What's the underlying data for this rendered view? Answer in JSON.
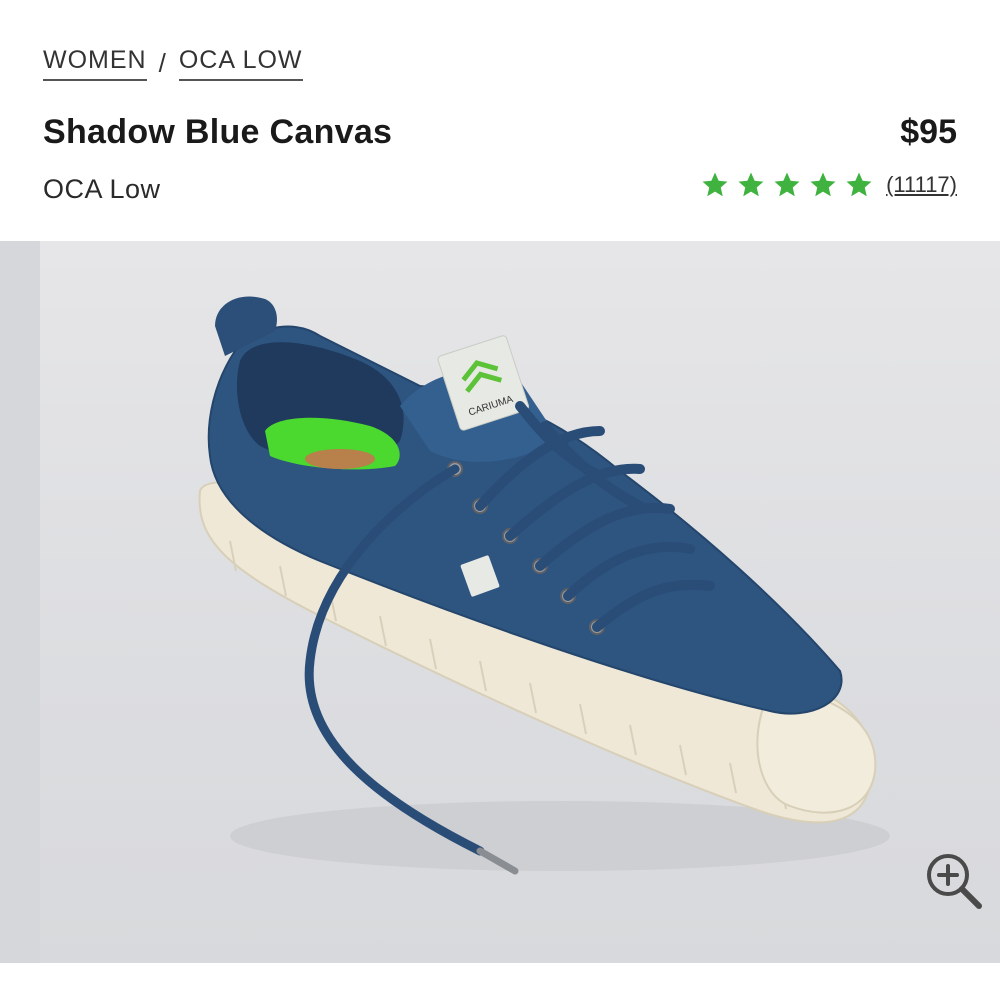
{
  "breadcrumb": {
    "items": [
      {
        "label": "WOMEN"
      },
      {
        "label": "OCA LOW"
      }
    ],
    "separator": "/"
  },
  "product": {
    "title": "Shadow Blue Canvas",
    "subtitle": "OCA Low",
    "price": "$95",
    "rating": {
      "stars": 5,
      "star_color": "#3fb23f",
      "review_count": "(11117)"
    }
  },
  "image": {
    "alt": "Shadow Blue Canvas OCA Low sneaker",
    "brand_tag": "CARIUMA",
    "canvas_color": "#2e5480",
    "sole_color": "#efe8d6",
    "insole_color": "#4bd82f"
  },
  "icons": {
    "zoom": "zoom-in-icon",
    "star": "star-icon"
  }
}
